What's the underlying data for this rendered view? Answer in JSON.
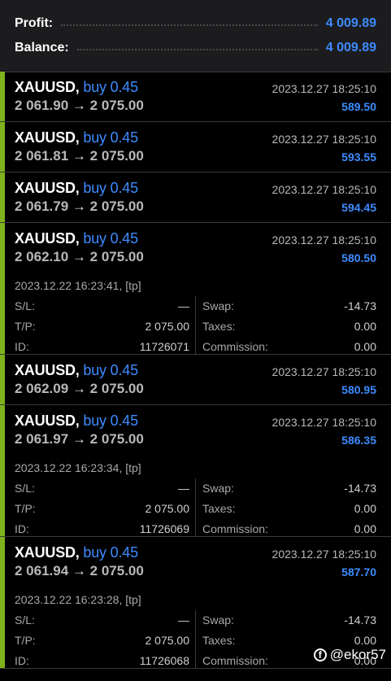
{
  "summary": {
    "profit_label": "Profit:",
    "profit_value": "4 009.89",
    "balance_label": "Balance:",
    "balance_value": "4 009.89"
  },
  "arrow": "→",
  "trades": [
    {
      "symbol": "XAUUSD,",
      "type": "buy 0.45",
      "open_price": "2 061.90",
      "close_price": "2 075.00",
      "time": "2023.12.27 18:25:10",
      "profit": "589.50",
      "expanded": false
    },
    {
      "symbol": "XAUUSD,",
      "type": "buy 0.45",
      "open_price": "2 061.81",
      "close_price": "2 075.00",
      "time": "2023.12.27 18:25:10",
      "profit": "593.55",
      "expanded": false
    },
    {
      "symbol": "XAUUSD,",
      "type": "buy 0.45",
      "open_price": "2 061.79",
      "close_price": "2 075.00",
      "time": "2023.12.27 18:25:10",
      "profit": "594.45",
      "expanded": false
    },
    {
      "symbol": "XAUUSD,",
      "type": "buy 0.45",
      "open_price": "2 062.10",
      "close_price": "2 075.00",
      "time": "2023.12.27 18:25:10",
      "profit": "580.50",
      "expanded": true,
      "opened": "2023.12.22 16:23:41, [tp]",
      "sl_label": "S/L:",
      "sl": "—",
      "tp_label": "T/P:",
      "tp": "2 075.00",
      "id_label": "ID:",
      "id": "11726071",
      "swap_label": "Swap:",
      "swap": "-14.73",
      "taxes_label": "Taxes:",
      "taxes": "0.00",
      "commission_label": "Commission:",
      "commission": "0.00"
    },
    {
      "symbol": "XAUUSD,",
      "type": "buy 0.45",
      "open_price": "2 062.09",
      "close_price": "2 075.00",
      "time": "2023.12.27 18:25:10",
      "profit": "580.95",
      "expanded": false
    },
    {
      "symbol": "XAUUSD,",
      "type": "buy 0.45",
      "open_price": "2 061.97",
      "close_price": "2 075.00",
      "time": "2023.12.27 18:25:10",
      "profit": "586.35",
      "expanded": true,
      "opened": "2023.12.22 16:23:34, [tp]",
      "sl_label": "S/L:",
      "sl": "—",
      "tp_label": "T/P:",
      "tp": "2 075.00",
      "id_label": "ID:",
      "id": "11726069",
      "swap_label": "Swap:",
      "swap": "-14.73",
      "taxes_label": "Taxes:",
      "taxes": "0.00",
      "commission_label": "Commission:",
      "commission": "0.00"
    },
    {
      "symbol": "XAUUSD,",
      "type": "buy 0.45",
      "open_price": "2 061.94",
      "close_price": "2 075.00",
      "time": "2023.12.27 18:25:10",
      "profit": "587.70",
      "expanded": true,
      "opened": "2023.12.22 16:23:28, [tp]",
      "sl_label": "S/L:",
      "sl": "—",
      "tp_label": "T/P:",
      "tp": "2 075.00",
      "id_label": "ID:",
      "id": "11726068",
      "swap_label": "Swap:",
      "swap": "-14.73",
      "taxes_label": "Taxes:",
      "taxes": "0.00",
      "commission_label": "Commission:",
      "commission": "0.00"
    }
  ],
  "watermark": {
    "icon": "facebook-icon",
    "text": "@ekor57"
  },
  "colors": {
    "accent": "#3d8bff",
    "bar": "#7fb21c",
    "background": "#000000",
    "summary_bg": "#1c1c1e"
  }
}
